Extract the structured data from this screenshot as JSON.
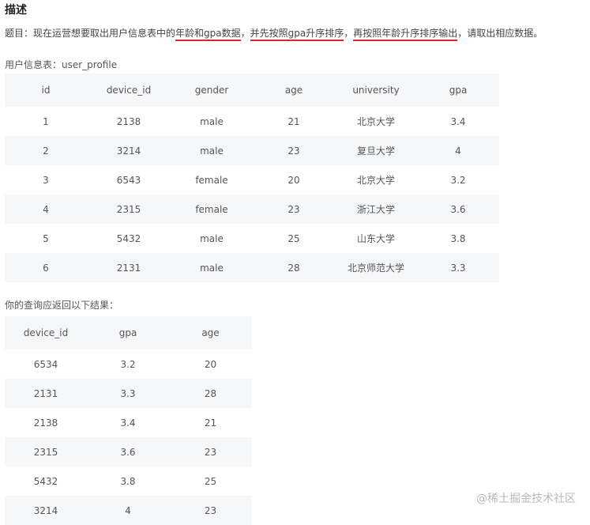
{
  "heading": "描述",
  "description": {
    "prefix": "题目：现在运营想要取出用户信息表中的",
    "hl1": "年龄和gpa数据",
    "sep1": "，",
    "hl2": "并先按照gpa升序排序",
    "sep2": "，",
    "hl3": "再按照年龄升序排序输出",
    "suffix": "，请取出相应数据。"
  },
  "table1": {
    "caption": "用户信息表：user_profile",
    "columns": [
      "id",
      "device_id",
      "gender",
      "age",
      "university",
      "gpa"
    ],
    "rows": [
      [
        "1",
        "2138",
        "male",
        "21",
        "北京大学",
        "3.4"
      ],
      [
        "2",
        "3214",
        "male",
        "23",
        "复旦大学",
        "4"
      ],
      [
        "3",
        "6543",
        "female",
        "20",
        "北京大学",
        "3.2"
      ],
      [
        "4",
        "2315",
        "female",
        "23",
        "浙江大学",
        "3.6"
      ],
      [
        "5",
        "5432",
        "male",
        "25",
        "山东大学",
        "3.8"
      ],
      [
        "6",
        "2131",
        "male",
        "28",
        "北京师范大学",
        "3.3"
      ]
    ]
  },
  "table2": {
    "caption": "你的查询应返回以下结果：",
    "columns": [
      "device_id",
      "gpa",
      "age"
    ],
    "rows": [
      [
        "6534",
        "3.2",
        "20"
      ],
      [
        "2131",
        "3.3",
        "28"
      ],
      [
        "2138",
        "3.4",
        "21"
      ],
      [
        "2315",
        "3.6",
        "23"
      ],
      [
        "5432",
        "3.8",
        "25"
      ],
      [
        "3214",
        "4",
        "23"
      ]
    ]
  },
  "watermark": "@稀土掘金技术社区",
  "colors": {
    "highlight_underline": "#d42a2a",
    "stripe": "#f6f7f9"
  }
}
